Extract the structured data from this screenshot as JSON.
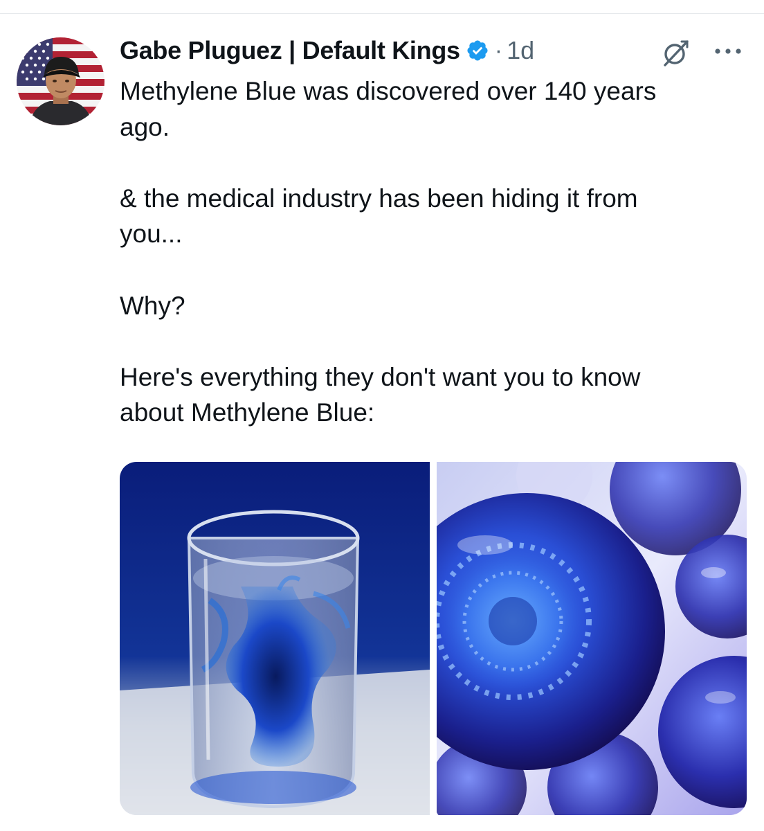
{
  "author": {
    "name": "Gabe Pluguez | Default Kings",
    "verified": true,
    "avatar_icon": "avatar-flag-portrait"
  },
  "meta": {
    "separator": "·",
    "time_ago": "1d"
  },
  "icons": {
    "verified": "verified-badge-icon",
    "grok": "grok-icon",
    "more": "more-options-icon"
  },
  "tweet": {
    "line1": "Methylene Blue was discovered over 140 years",
    "line2": "ago.",
    "para2_line1": "& the medical industry has been hiding it from",
    "para2_line2": "you...",
    "para3": "Why?",
    "para4_line1": "Here's everything they don't want you to know",
    "para4_line2": "about Methylene Blue:"
  },
  "media": [
    {
      "name": "glass-of-water-with-blue-dye-photo"
    },
    {
      "name": "blue-cells-microscopy-photo"
    }
  ],
  "colors": {
    "text": "#0f1419",
    "secondary": "#536471",
    "verified": "#1d9bf0",
    "flag_red": "#b22234",
    "flag_blue": "#3c3b6e",
    "dye_blue": "#1b48c8"
  }
}
